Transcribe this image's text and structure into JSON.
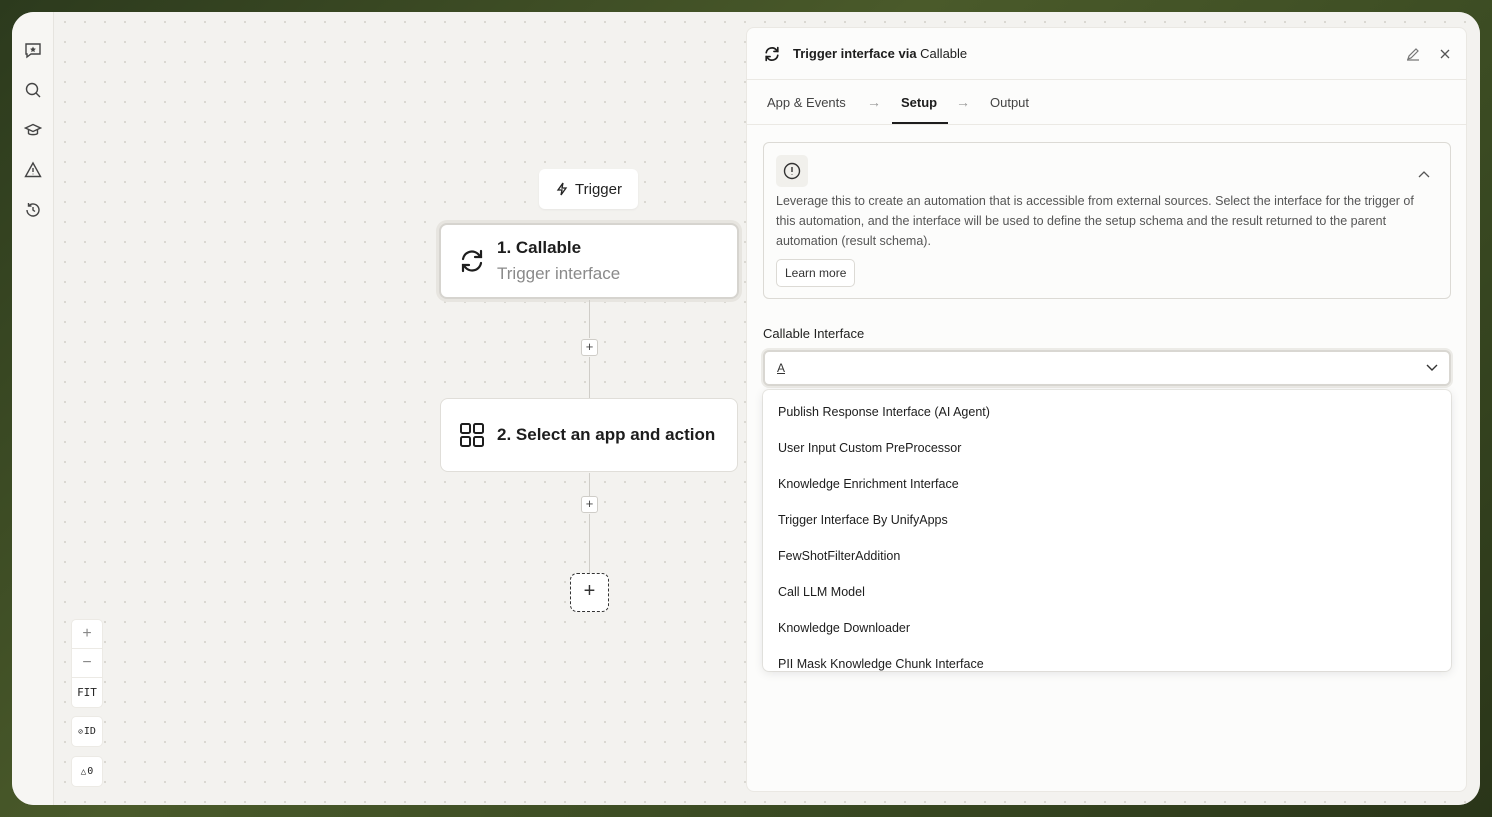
{
  "sidebar": {
    "icons": [
      "ai-chat-icon",
      "search-icon",
      "graduation-cap-icon",
      "warning-icon",
      "history-icon"
    ]
  },
  "canvas": {
    "trigger_chip_label": "Trigger",
    "node1": {
      "title": "1. Callable",
      "subtitle": "Trigger interface"
    },
    "node2": {
      "title": "2. Select an app and action"
    },
    "add_step_symbol": "+",
    "zoom": {
      "in": "+",
      "out": "−",
      "fit": "FIT"
    },
    "id_toggle": "ID",
    "warnings_count": "0"
  },
  "panel": {
    "title_bold": "Trigger interface via ",
    "title_app": "Callable",
    "tabs": [
      {
        "label": "App & Events"
      },
      {
        "label": "Setup"
      },
      {
        "label": "Output"
      }
    ],
    "active_tab": "Setup",
    "info": {
      "text": "Leverage this to create an automation that is accessible from external sources. Select the interface for the trigger of this automation, and the interface will be used to define the setup schema and the result returned to the parent automation (result schema).",
      "learn_more": "Learn more"
    },
    "field": {
      "label": "Callable Interface",
      "value": "A"
    },
    "options": [
      "Publish Response Interface (AI Agent)",
      "User Input Custom PreProcessor",
      "Knowledge Enrichment Interface",
      "Trigger Interface By UnifyApps",
      "FewShotFilterAddition",
      "Call LLM Model",
      "Knowledge Downloader",
      "PII Mask Knowledge Chunk Interface"
    ]
  }
}
